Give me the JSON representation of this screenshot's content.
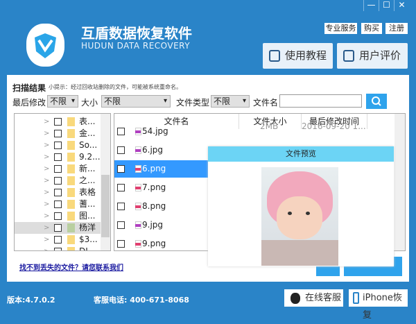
{
  "window": {
    "minimize": "—",
    "maximize": "☐",
    "close": "✕"
  },
  "header": {
    "title": "互盾数据恢复软件",
    "subtitle": "HUDUN DATA RECOVERY",
    "links": [
      "专业服务",
      "购买",
      "注册"
    ],
    "tutorial": "使用教程",
    "review": "用户评价"
  },
  "scan": {
    "title": "扫描结果",
    "tip": "小提示：经过回收站删除的文件，可能被系统重命名。"
  },
  "filters": {
    "modified_label": "最后修改",
    "modified_value": "不限",
    "size_label": "大小",
    "size_value": "不限",
    "type_label": "文件类型",
    "type_value": "不限",
    "name_label": "文件名",
    "name_value": "",
    "search_icon": "search-icon"
  },
  "tree": [
    "表...",
    "金...",
    "So...",
    "9.2...",
    "新...",
    "之...",
    "表格",
    "蓍...",
    "图...",
    "杨洋",
    "$3...",
    "DI..."
  ],
  "list": {
    "headers": [
      "文件名",
      "文件大小",
      "最后修改时间"
    ],
    "rows": [
      {
        "name": "54.jpg",
        "size": "2MB",
        "date": "2016-09-20 1..."
      },
      {
        "name": "6.jpg"
      },
      {
        "name": "6.png",
        "selected": true
      },
      {
        "name": "7.png"
      },
      {
        "name": "8.png"
      },
      {
        "name": "9.jpg"
      },
      {
        "name": "9.png"
      }
    ]
  },
  "preview": {
    "title": "文件预览"
  },
  "help_link": "找不到丢失的文件？请您联系我们",
  "footer": {
    "version": "版本:4.7.0.2",
    "phone": "客服电话: 400-671-8068",
    "online": "在线客服",
    "iphone": "iPhone恢复"
  },
  "colors": {
    "brand": "#2a84c8",
    "selected": "#3399ff",
    "preview_header": "#6cd4f5"
  }
}
